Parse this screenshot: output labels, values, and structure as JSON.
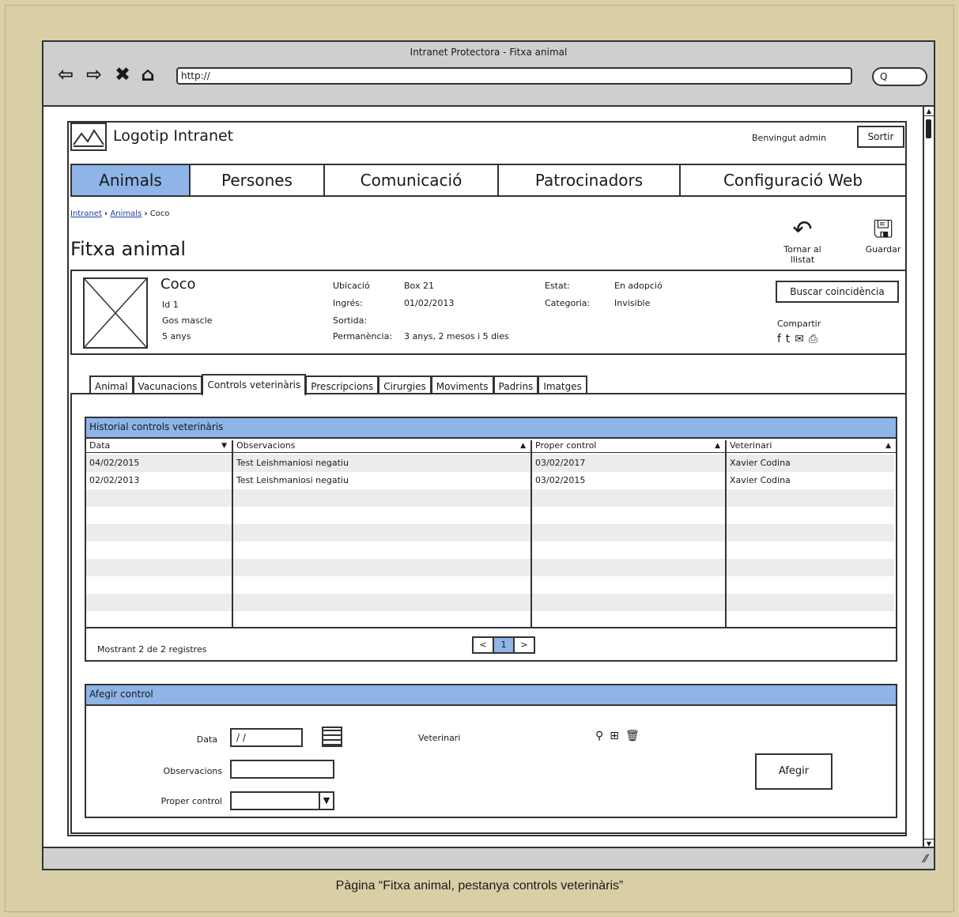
{
  "window": {
    "title": "Intranet Protectora - Fitxa animal",
    "url": "http://",
    "search_label": "Q"
  },
  "nav_icons": {
    "back": "back-arrow-icon",
    "forward": "forward-arrow-icon",
    "stop": "close-icon",
    "home": "home-icon"
  },
  "header": {
    "logo_text": "Logotip Intranet",
    "welcome": "Benvingut admin",
    "logout": "Sortir"
  },
  "topnav": [
    "Animals",
    "Persones",
    "Comunicació",
    "Patrocinadors",
    "Configuració Web"
  ],
  "breadcrumb": {
    "items": [
      "Intranet",
      "Animals",
      "Coco"
    ],
    "separator": "›"
  },
  "page": {
    "title": "Fitxa animal",
    "back_label": "Tornar al llistat",
    "save_label": "Guardar"
  },
  "animal": {
    "name": "Coco",
    "id": "Id 1",
    "type": "Gos mascle",
    "age": "5 anys",
    "ubicacio_label": "Ubicació",
    "ubicacio": "Box 21",
    "ingres_label": "Ingrés:",
    "ingres": "01/02/2013",
    "sortida_label": "Sortida:",
    "permanencia_label": "Permanència:",
    "permanencia": "3 anys, 2 mesos i 5 dies",
    "estat_label": "Estat:",
    "estat": "En adopció",
    "categoria_label": "Categoria:",
    "categoria": "Invisible",
    "buscar": "Buscar coincidència",
    "compartir": "Compartir"
  },
  "tabs": [
    "Animal",
    "Vacunacions",
    "Controls veterinàris",
    "Prescripcions",
    "Cirurgies",
    "Moviments",
    "Padrins",
    "Imatges"
  ],
  "historial": {
    "title": "Historial controls veterinàris",
    "columns": [
      "Data",
      "Observacions",
      "Proper control",
      "Veterinari"
    ],
    "sort_arrows": [
      "▼",
      "▲",
      "▲",
      "▲"
    ],
    "rows": [
      [
        "04/02/2015",
        "Test Leishmaniosi negatiu",
        "03/02/2017",
        "Xavier Codina"
      ],
      [
        "02/02/2013",
        "Test Leishmaniosi negatiu",
        "03/02/2015",
        "Xavier Codina"
      ]
    ],
    "footer": "Mostrant 2 de 2 registres",
    "pager": [
      "<",
      "1",
      ">"
    ]
  },
  "afegir": {
    "title": "Afegir control",
    "data_label": "Data",
    "data_value": "/ /",
    "observacions_label": "Observacions",
    "proper_label": "Proper control",
    "veterinari_label": "Veterinari",
    "button": "Afegir"
  },
  "caption": "Pàgina “Fitxa animal, pestanya controls veterinàris”",
  "colors": {
    "accent": "#8eb4e8",
    "background": "#d9d0a8",
    "chrome": "#cfcfcf"
  }
}
